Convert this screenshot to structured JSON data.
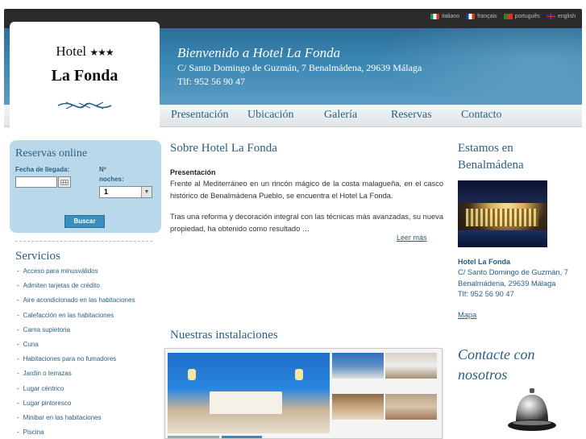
{
  "languages": [
    {
      "label": "italiano",
      "flag": "italy-flag-icon"
    },
    {
      "label": "français",
      "flag": "france-flag-icon"
    },
    {
      "label": "português",
      "flag": "portugal-flag-icon"
    },
    {
      "label": "english",
      "flag": "uk-flag-icon"
    }
  ],
  "logo": {
    "hotel": "Hotel",
    "stars": "★★★",
    "name": "La Fonda"
  },
  "banner": {
    "title": "Bienvenido a Hotel La Fonda",
    "address": "C/ Santo Domingo de Guzmán, 7 Benalmádena, 29639 Málaga",
    "phone": "Tlf: 952 56 90 47"
  },
  "nav": [
    "Presentación",
    "Ubicación",
    "Galería",
    "Reservas",
    "Contacto"
  ],
  "reservas": {
    "title": "Reservas online",
    "fecha_label": "Fecha de llegada:",
    "noches_label_1": "Nº",
    "noches_label_2": "noches:",
    "noches_value": "1",
    "fecha_value": "",
    "buscar": "Buscar"
  },
  "servicios": {
    "title": "Servicios",
    "items": [
      "Acceso para minusválidos",
      "Admiten tarjetas de crédito",
      "Aire acondicionado en las habitaciones",
      "Calefacción en las habitaciones",
      "Cama supletoria",
      "Cuna",
      "Habitaciones para no fumadores",
      "Jardín o terrazas",
      "Lugar céntrico",
      "Lugar pintoresco",
      "Minibar en las habitaciones",
      "Piscina"
    ]
  },
  "main": {
    "title": "Sobre Hotel La Fonda",
    "pres_label": "Presentación",
    "pres_text": "Frente al Mediterráneo en un rincón mágico de la costa malagueña, en el casco histórico de Benalmádena Pueblo, se encuentra el Hotel La Fonda.",
    "pres_text2": "Tras una reforma y decoración integral con las técnicas más avanzadas, su nueva propiedad, ha obtenido como resultado …",
    "leer_mas": "Leer más",
    "instalaciones_title": "Nuestras instalaciones"
  },
  "right": {
    "estamos_1": "Estamos en",
    "estamos_2": "Benalmádena",
    "hotel_name": "Hotel La Fonda",
    "hotel_addr": "C/ Santo Domingo de Guzmán, 7 Benalmádena, 29639 Málaga",
    "hotel_phone": "Tlf: 952 56 90 47",
    "mapa": "Mapa",
    "contacte_1": "Contacte con",
    "contacte_2": "nosotros"
  }
}
